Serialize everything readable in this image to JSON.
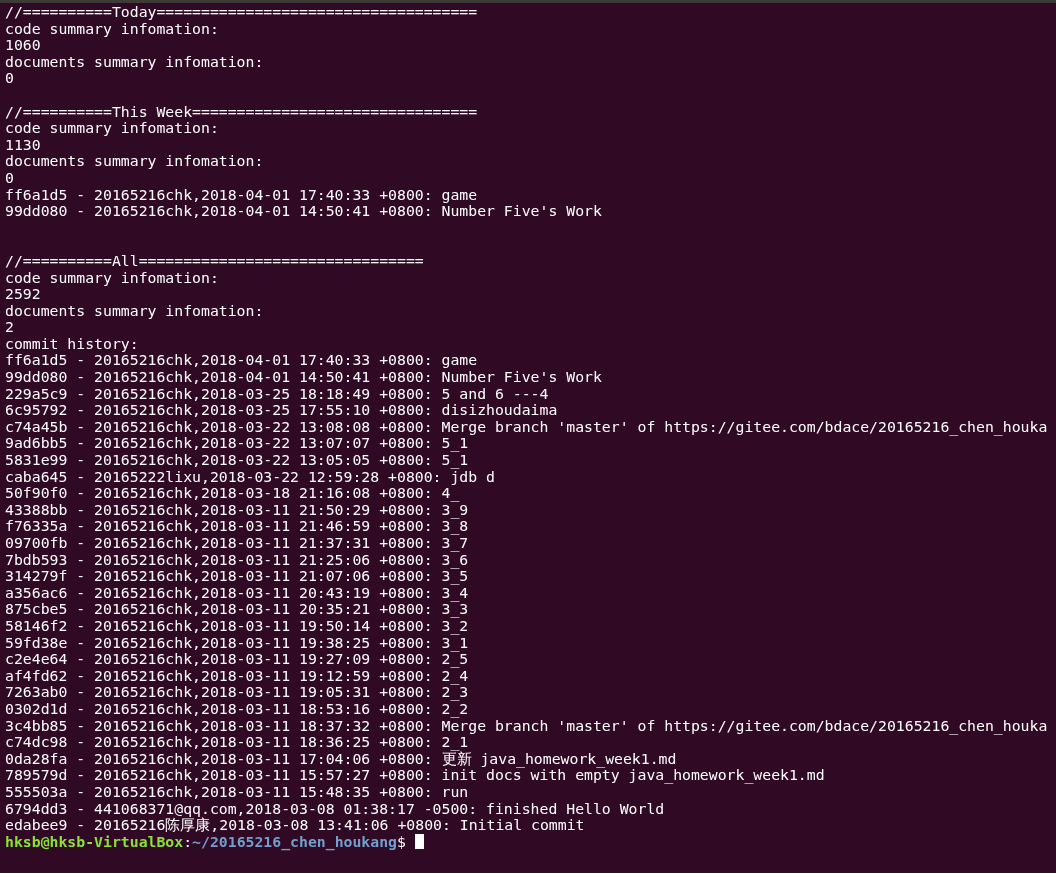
{
  "terminal": {
    "lines": [
      {
        "kind": "text",
        "text": "//==========Today===================================="
      },
      {
        "kind": "text",
        "text": "code summary infomation:"
      },
      {
        "kind": "text",
        "text": "1060"
      },
      {
        "kind": "text",
        "text": "documents summary infomation:"
      },
      {
        "kind": "text",
        "text": "0"
      },
      {
        "kind": "blank"
      },
      {
        "kind": "text",
        "text": "//==========This Week================================"
      },
      {
        "kind": "text",
        "text": "code summary infomation:"
      },
      {
        "kind": "text",
        "text": "1130"
      },
      {
        "kind": "text",
        "text": "documents summary infomation:"
      },
      {
        "kind": "text",
        "text": "0"
      },
      {
        "kind": "text",
        "text": "ff6a1d5 - 20165216chk,2018-04-01 17:40:33 +0800: game"
      },
      {
        "kind": "text",
        "text": "99dd080 - 20165216chk,2018-04-01 14:50:41 +0800: Number Five's Work"
      },
      {
        "kind": "blank"
      },
      {
        "kind": "blank"
      },
      {
        "kind": "text",
        "text": "//==========All================================"
      },
      {
        "kind": "text",
        "text": "code summary infomation:"
      },
      {
        "kind": "text",
        "text": "2592"
      },
      {
        "kind": "text",
        "text": "documents summary infomation:"
      },
      {
        "kind": "text",
        "text": "2"
      },
      {
        "kind": "text",
        "text": "commit history:"
      },
      {
        "kind": "text",
        "text": "ff6a1d5 - 20165216chk,2018-04-01 17:40:33 +0800: game"
      },
      {
        "kind": "text",
        "text": "99dd080 - 20165216chk,2018-04-01 14:50:41 +0800: Number Five's Work"
      },
      {
        "kind": "text",
        "text": "229a5c9 - 20165216chk,2018-03-25 18:18:49 +0800: 5 and 6 ---4"
      },
      {
        "kind": "text",
        "text": "6c95792 - 20165216chk,2018-03-25 17:55:10 +0800: disizhoudaima"
      },
      {
        "kind": "text",
        "text": "c74a45b - 20165216chk,2018-03-22 13:08:08 +0800: Merge branch 'master' of https://gitee.com/bdace/20165216_chen_houka"
      },
      {
        "kind": "text",
        "text": "9ad6bb5 - 20165216chk,2018-03-22 13:07:07 +0800: 5_1"
      },
      {
        "kind": "text",
        "text": "5831e99 - 20165216chk,2018-03-22 13:05:05 +0800: 5_1"
      },
      {
        "kind": "text",
        "text": "caba645 - 20165222lixu,2018-03-22 12:59:28 +0800: jdb d"
      },
      {
        "kind": "text",
        "text": "50f90f0 - 20165216chk,2018-03-18 21:16:08 +0800: 4_"
      },
      {
        "kind": "text",
        "text": "43388bb - 20165216chk,2018-03-11 21:50:29 +0800: 3_9"
      },
      {
        "kind": "text",
        "text": "f76335a - 20165216chk,2018-03-11 21:46:59 +0800: 3_8"
      },
      {
        "kind": "text",
        "text": "09700fb - 20165216chk,2018-03-11 21:37:31 +0800: 3_7"
      },
      {
        "kind": "text",
        "text": "7bdb593 - 20165216chk,2018-03-11 21:25:06 +0800: 3_6"
      },
      {
        "kind": "text",
        "text": "314279f - 20165216chk,2018-03-11 21:07:06 +0800: 3_5"
      },
      {
        "kind": "text",
        "text": "a356ac6 - 20165216chk,2018-03-11 20:43:19 +0800: 3_4"
      },
      {
        "kind": "text",
        "text": "875cbe5 - 20165216chk,2018-03-11 20:35:21 +0800: 3_3"
      },
      {
        "kind": "text",
        "text": "58146f2 - 20165216chk,2018-03-11 19:50:14 +0800: 3_2"
      },
      {
        "kind": "text",
        "text": "59fd38e - 20165216chk,2018-03-11 19:38:25 +0800: 3_1"
      },
      {
        "kind": "text",
        "text": "c2e4e64 - 20165216chk,2018-03-11 19:27:09 +0800: 2_5"
      },
      {
        "kind": "text",
        "text": "af4fd62 - 20165216chk,2018-03-11 19:12:59 +0800: 2_4"
      },
      {
        "kind": "text",
        "text": "7263ab0 - 20165216chk,2018-03-11 19:05:31 +0800: 2_3"
      },
      {
        "kind": "text",
        "text": "0302d1d - 20165216chk,2018-03-11 18:53:16 +0800: 2_2"
      },
      {
        "kind": "text",
        "text": "3c4bb85 - 20165216chk,2018-03-11 18:37:32 +0800: Merge branch 'master' of https://gitee.com/bdace/20165216_chen_houka"
      },
      {
        "kind": "text",
        "text": "c74dc98 - 20165216chk,2018-03-11 18:36:25 +0800: 2_1"
      },
      {
        "kind": "text",
        "text": "0da28fa - 20165216chk,2018-03-11 17:04:06 +0800: 更新 java_homework_week1.md"
      },
      {
        "kind": "text",
        "text": "789579d - 20165216chk,2018-03-11 15:57:27 +0800: init docs with empty java_homework_week1.md"
      },
      {
        "kind": "text",
        "text": "555503a - 20165216chk,2018-03-11 15:48:35 +0800: run"
      },
      {
        "kind": "text",
        "text": "6794dd3 - 441068371@qq.com,2018-03-08 01:38:17 -0500: finished Hello World"
      },
      {
        "kind": "text",
        "text": "edabee9 - 20165216陈厚康,2018-03-08 13:41:06 +0800: Initial commit"
      }
    ],
    "prompt": {
      "user_host": "hksb@hksb-VirtualBox",
      "separator": ":",
      "path": "~/20165216_chen_houkang",
      "symbol": "$"
    }
  }
}
